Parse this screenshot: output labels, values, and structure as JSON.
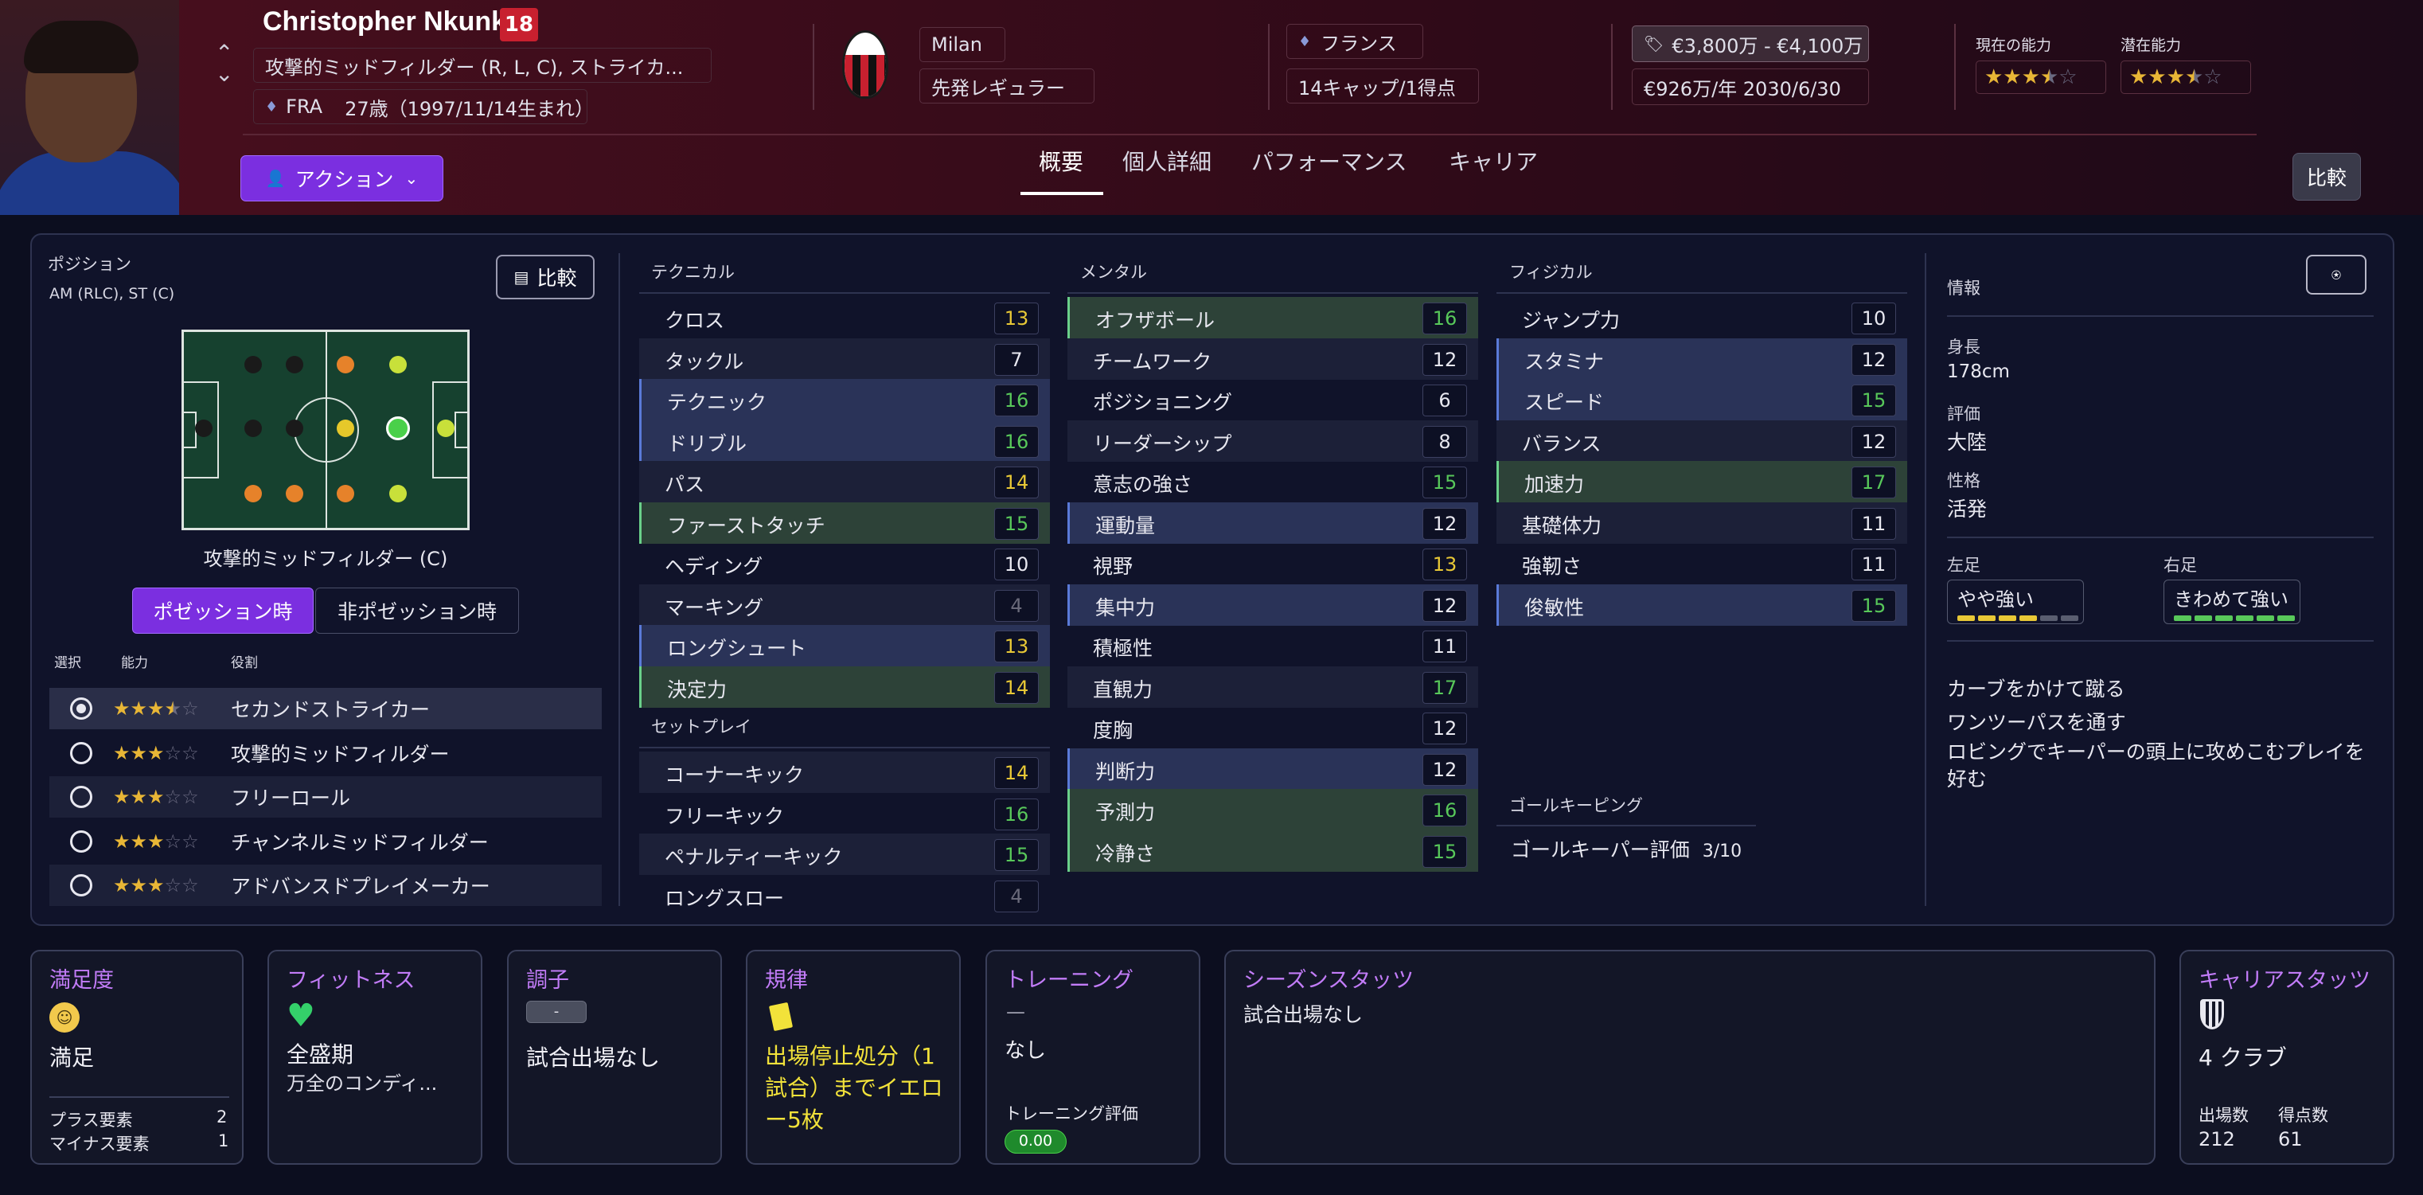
{
  "header": {
    "name": "Christopher Nkunku",
    "squad_number": "18",
    "positions": "攻撃的ミッドフィルダー (R, L, C), ストライカ...",
    "nationality_code": "FRA",
    "age_birth": "27歳（1997/11/14生まれ）",
    "club": "Milan",
    "squad_status": "先発レギュラー",
    "nation": "フランス",
    "caps_goals": "14キャップ/1得点",
    "value": "€3,800万 - €4,100万",
    "wage_contract": "€926万/年 2030/6/30",
    "current_ability_label": "現在の能力",
    "potential_ability_label": "潜在能力",
    "current_ability_stars": 3.5,
    "potential_ability_stars": 3.5,
    "action_button": "アクション",
    "compare_button": "比較",
    "tabs": [
      "概要",
      "個人詳細",
      "パフォーマンス",
      "キャリア"
    ],
    "active_tab": 0,
    "nav_up": "⌃",
    "nav_down": "⌄"
  },
  "position_panel": {
    "title": "ポジション",
    "positions": "AM (RLC), ST (C)",
    "compare_button": "比較",
    "role_name": "攻撃的ミッドフィルダー (C)",
    "in_possession": "ポゼッション時",
    "out_possession": "非ポゼッション時",
    "col_select": "選択",
    "col_ability": "能力",
    "col_role": "役割",
    "roles": [
      {
        "name": "セカンドストライカー",
        "stars": 3.5,
        "selected": true
      },
      {
        "name": "攻撃的ミッドフィルダー",
        "stars": 3,
        "selected": false
      },
      {
        "name": "フリーロール",
        "stars": 3,
        "selected": false
      },
      {
        "name": "チャンネルミッドフィルダー",
        "stars": 3,
        "selected": false
      },
      {
        "name": "アドバンスドプレイメーカー",
        "stars": 3,
        "selected": false
      }
    ]
  },
  "technical": {
    "title": "テクニカル",
    "attrs": [
      {
        "name": "クロス",
        "value": "13"
      },
      {
        "name": "タックル",
        "value": "7"
      },
      {
        "name": "テクニック",
        "value": "16"
      },
      {
        "name": "ドリブル",
        "value": "16"
      },
      {
        "name": "パス",
        "value": "14"
      },
      {
        "name": "ファーストタッチ",
        "value": "15"
      },
      {
        "name": "ヘディング",
        "value": "10"
      },
      {
        "name": "マーキング",
        "value": "4"
      },
      {
        "name": "ロングシュート",
        "value": "13"
      },
      {
        "name": "決定力",
        "value": "14"
      }
    ]
  },
  "setpieces": {
    "title": "セットプレイ",
    "attrs": [
      {
        "name": "コーナーキック",
        "value": "14"
      },
      {
        "name": "フリーキック",
        "value": "16"
      },
      {
        "name": "ペナルティーキック",
        "value": "15"
      },
      {
        "name": "ロングスロー",
        "value": "4"
      }
    ]
  },
  "mental": {
    "title": "メンタル",
    "attrs": [
      {
        "name": "オフザボール",
        "value": "16"
      },
      {
        "name": "チームワーク",
        "value": "12"
      },
      {
        "name": "ポジショニング",
        "value": "6"
      },
      {
        "name": "リーダーシップ",
        "value": "8"
      },
      {
        "name": "意志の強さ",
        "value": "15"
      },
      {
        "name": "運動量",
        "value": "12"
      },
      {
        "name": "視野",
        "value": "13"
      },
      {
        "name": "集中力",
        "value": "12"
      },
      {
        "name": "積極性",
        "value": "11"
      },
      {
        "name": "直観力",
        "value": "17"
      },
      {
        "name": "度胸",
        "value": "12"
      },
      {
        "name": "判断力",
        "value": "12"
      },
      {
        "name": "予測力",
        "value": "16"
      },
      {
        "name": "冷静さ",
        "value": "15"
      }
    ]
  },
  "physical": {
    "title": "フィジカル",
    "attrs": [
      {
        "name": "ジャンプ力",
        "value": "10"
      },
      {
        "name": "スタミナ",
        "value": "12"
      },
      {
        "name": "スピード",
        "value": "15"
      },
      {
        "name": "バランス",
        "value": "12"
      },
      {
        "name": "加速力",
        "value": "17"
      },
      {
        "name": "基礎体力",
        "value": "11"
      },
      {
        "name": "強靭さ",
        "value": "11"
      },
      {
        "name": "俊敏性",
        "value": "15"
      }
    ]
  },
  "goalkeeping": {
    "title": "ゴールキーピング",
    "rating": "ゴールキーパー評価",
    "rating_value": "3/10"
  },
  "info": {
    "title": "情報",
    "height_label": "身長",
    "height": "178cm",
    "reputation_label": "評価",
    "reputation": "大陸",
    "personality_label": "性格",
    "personality": "活発",
    "left_foot_label": "左足",
    "left_foot": "やや強い",
    "left_foot_level": 4,
    "right_foot_label": "右足",
    "right_foot": "きわめて強い",
    "right_foot_level": 6,
    "traits": [
      "カーブをかけて蹴る",
      "ワンツーパスを通す",
      "ロビングでキーパーの頭上に攻めこむプレイを好む"
    ]
  },
  "cards": {
    "satisfaction": {
      "title": "満足度",
      "value": "満足",
      "plus_label": "プラス要素",
      "plus": "2",
      "minus_label": "マイナス要素",
      "minus": "1"
    },
    "fitness": {
      "title": "フィットネス",
      "value": "全盛期",
      "sub": "万全のコンディ..."
    },
    "form": {
      "title": "調子",
      "badge": "-",
      "value": "試合出場なし"
    },
    "discipline": {
      "title": "規律",
      "value": "出場停止処分（1試合）までイエロー5枚"
    },
    "training": {
      "title": "トレーニング",
      "dash": "—",
      "value": "なし",
      "rating_label": "トレーニング評価",
      "rating": "0.00"
    },
    "season": {
      "title": "シーズンスタッツ",
      "value": "試合出場なし"
    },
    "career": {
      "title": "キャリアスタッツ",
      "value": "4 クラブ",
      "apps_label": "出場数",
      "apps": "212",
      "goals_label": "得点数",
      "goals": "61"
    }
  },
  "colors": {
    "accent": "#7b2fe0",
    "good": "#58c85a",
    "mid": "#e8c836",
    "star": "#e8b636",
    "card_title": "#c27cf8"
  }
}
